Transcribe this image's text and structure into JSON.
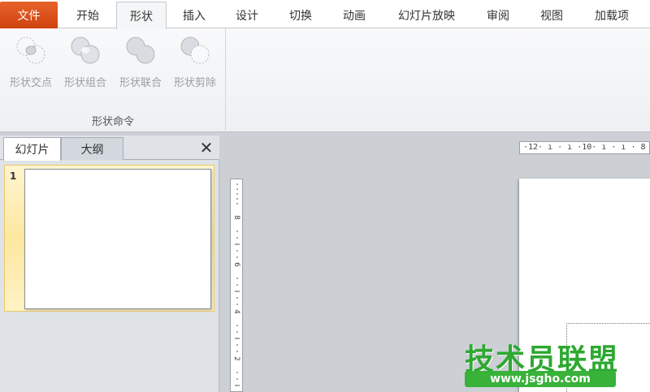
{
  "tabs": {
    "file": "文件",
    "items": [
      {
        "label": "开始"
      },
      {
        "label": "形状"
      },
      {
        "label": "插入"
      },
      {
        "label": "设计"
      },
      {
        "label": "切换"
      },
      {
        "label": "动画"
      },
      {
        "label": "幻灯片放映"
      },
      {
        "label": "审阅"
      },
      {
        "label": "视图"
      },
      {
        "label": "加载项"
      }
    ]
  },
  "ribbon": {
    "group_label": "形状命令",
    "commands": [
      {
        "label": "形状交点",
        "icon": "shape-intersect-icon"
      },
      {
        "label": "形状组合",
        "icon": "shape-combine-icon"
      },
      {
        "label": "形状联合",
        "icon": "shape-union-icon"
      },
      {
        "label": "形状剪除",
        "icon": "shape-subtract-icon"
      }
    ]
  },
  "panel": {
    "tabs": [
      {
        "label": "幻灯片"
      },
      {
        "label": "大纲"
      }
    ],
    "close": "✕",
    "slides": [
      {
        "number": "1"
      }
    ]
  },
  "ruler": {
    "horizontal": "·12· ı · ı ·10· ı · ı · 8 · ı · ı",
    "vertical_marks": [
      "8",
      "6",
      "4",
      "2"
    ]
  },
  "watermark": {
    "title": "技术员联盟",
    "url": "www.jsgho.com"
  },
  "colors": {
    "file_tab": "#d4491a",
    "watermark_green": "#2ea831"
  }
}
